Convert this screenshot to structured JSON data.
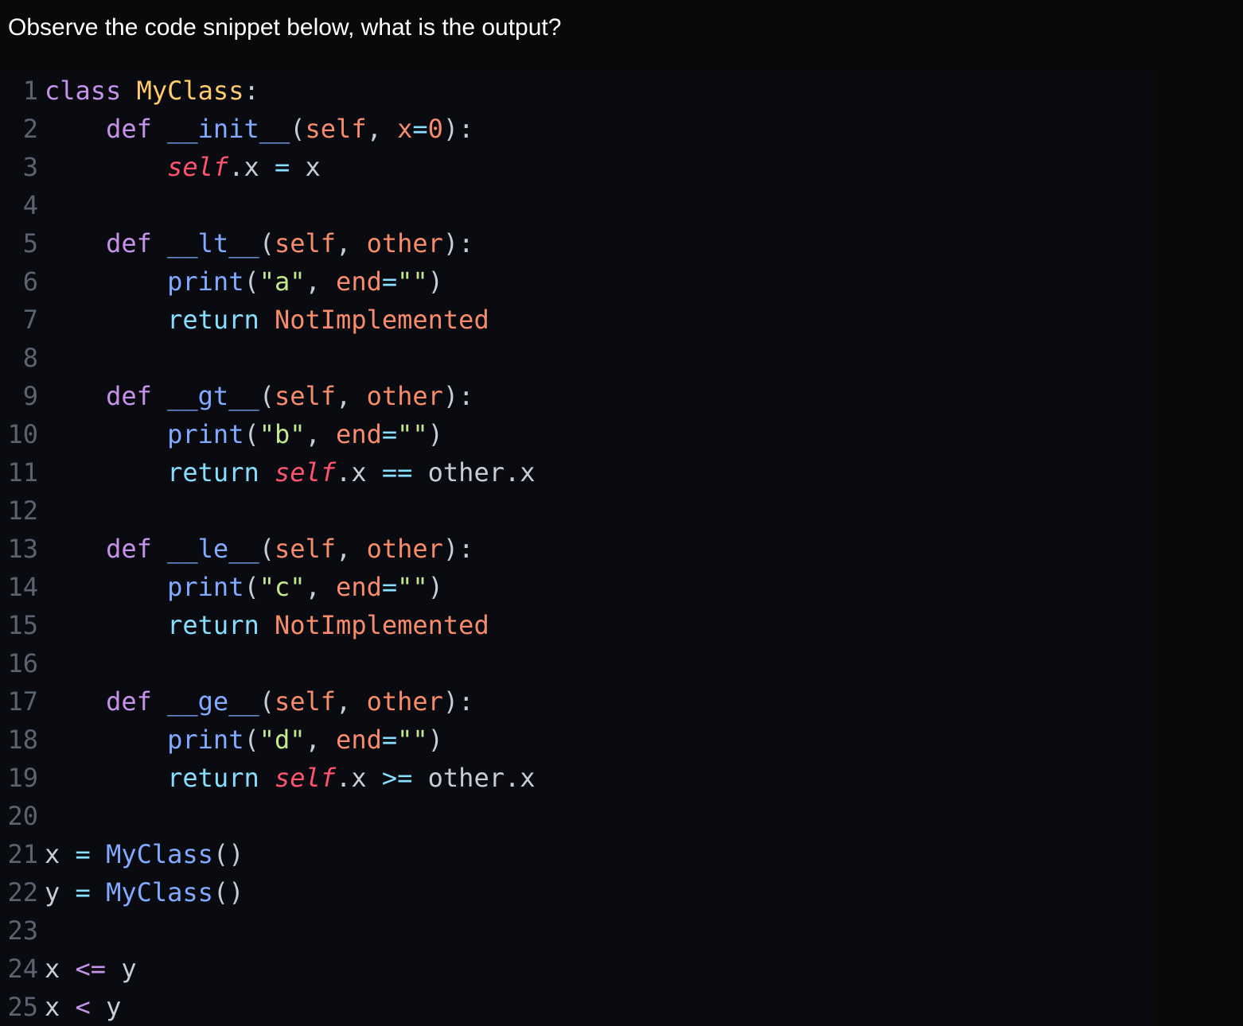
{
  "question": "Observe the code snippet below, what is the output?",
  "code": {
    "language": "python",
    "lines": [
      [
        {
          "t": "class",
          "c": "kw"
        },
        {
          "t": " "
        },
        {
          "t": "MyClass",
          "c": "cls"
        },
        {
          "t": ":"
        }
      ],
      [
        {
          "t": "    "
        },
        {
          "t": "def",
          "c": "kw"
        },
        {
          "t": " "
        },
        {
          "t": "__init__",
          "c": "fn"
        },
        {
          "t": "("
        },
        {
          "t": "self",
          "c": "prm"
        },
        {
          "t": ", "
        },
        {
          "t": "x",
          "c": "prm"
        },
        {
          "t": "=",
          "c": "op"
        },
        {
          "t": "0",
          "c": "num"
        },
        {
          "t": "):"
        }
      ],
      [
        {
          "t": "        "
        },
        {
          "t": "self",
          "c": "self"
        },
        {
          "t": ".x "
        },
        {
          "t": "=",
          "c": "op"
        },
        {
          "t": " x"
        }
      ],
      [],
      [
        {
          "t": "    "
        },
        {
          "t": "def",
          "c": "kw"
        },
        {
          "t": " "
        },
        {
          "t": "__lt__",
          "c": "fn"
        },
        {
          "t": "("
        },
        {
          "t": "self",
          "c": "prm"
        },
        {
          "t": ", "
        },
        {
          "t": "other",
          "c": "prm"
        },
        {
          "t": "):"
        }
      ],
      [
        {
          "t": "        "
        },
        {
          "t": "print",
          "c": "fn"
        },
        {
          "t": "("
        },
        {
          "t": "\"a\"",
          "c": "str"
        },
        {
          "t": ", "
        },
        {
          "t": "end",
          "c": "prm"
        },
        {
          "t": "=",
          "c": "op"
        },
        {
          "t": "\"\"",
          "c": "str"
        },
        {
          "t": ")"
        }
      ],
      [
        {
          "t": "        "
        },
        {
          "t": "return",
          "c": "ret"
        },
        {
          "t": " "
        },
        {
          "t": "NotImplemented",
          "c": "cst"
        }
      ],
      [],
      [
        {
          "t": "    "
        },
        {
          "t": "def",
          "c": "kw"
        },
        {
          "t": " "
        },
        {
          "t": "__gt__",
          "c": "fn"
        },
        {
          "t": "("
        },
        {
          "t": "self",
          "c": "prm"
        },
        {
          "t": ", "
        },
        {
          "t": "other",
          "c": "prm"
        },
        {
          "t": "):"
        }
      ],
      [
        {
          "t": "        "
        },
        {
          "t": "print",
          "c": "fn"
        },
        {
          "t": "("
        },
        {
          "t": "\"b\"",
          "c": "str"
        },
        {
          "t": ", "
        },
        {
          "t": "end",
          "c": "prm"
        },
        {
          "t": "=",
          "c": "op"
        },
        {
          "t": "\"\"",
          "c": "str"
        },
        {
          "t": ")"
        }
      ],
      [
        {
          "t": "        "
        },
        {
          "t": "return",
          "c": "ret"
        },
        {
          "t": " "
        },
        {
          "t": "self",
          "c": "self"
        },
        {
          "t": ".x "
        },
        {
          "t": "==",
          "c": "op"
        },
        {
          "t": " other.x"
        }
      ],
      [],
      [
        {
          "t": "    "
        },
        {
          "t": "def",
          "c": "kw"
        },
        {
          "t": " "
        },
        {
          "t": "__le__",
          "c": "fn"
        },
        {
          "t": "("
        },
        {
          "t": "self",
          "c": "prm"
        },
        {
          "t": ", "
        },
        {
          "t": "other",
          "c": "prm"
        },
        {
          "t": "):"
        }
      ],
      [
        {
          "t": "        "
        },
        {
          "t": "print",
          "c": "fn"
        },
        {
          "t": "("
        },
        {
          "t": "\"c\"",
          "c": "str"
        },
        {
          "t": ", "
        },
        {
          "t": "end",
          "c": "prm"
        },
        {
          "t": "=",
          "c": "op"
        },
        {
          "t": "\"\"",
          "c": "str"
        },
        {
          "t": ")"
        }
      ],
      [
        {
          "t": "        "
        },
        {
          "t": "return",
          "c": "ret"
        },
        {
          "t": " "
        },
        {
          "t": "NotImplemented",
          "c": "cst"
        }
      ],
      [],
      [
        {
          "t": "    "
        },
        {
          "t": "def",
          "c": "kw"
        },
        {
          "t": " "
        },
        {
          "t": "__ge__",
          "c": "fn"
        },
        {
          "t": "("
        },
        {
          "t": "self",
          "c": "prm"
        },
        {
          "t": ", "
        },
        {
          "t": "other",
          "c": "prm"
        },
        {
          "t": "):"
        }
      ],
      [
        {
          "t": "        "
        },
        {
          "t": "print",
          "c": "fn"
        },
        {
          "t": "("
        },
        {
          "t": "\"d\"",
          "c": "str"
        },
        {
          "t": ", "
        },
        {
          "t": "end",
          "c": "prm"
        },
        {
          "t": "=",
          "c": "op"
        },
        {
          "t": "\"\"",
          "c": "str"
        },
        {
          "t": ")"
        }
      ],
      [
        {
          "t": "        "
        },
        {
          "t": "return",
          "c": "ret"
        },
        {
          "t": " "
        },
        {
          "t": "self",
          "c": "self"
        },
        {
          "t": ".x "
        },
        {
          "t": ">=",
          "c": "op"
        },
        {
          "t": " other.x"
        }
      ],
      [],
      [
        {
          "t": "x "
        },
        {
          "t": "=",
          "c": "op"
        },
        {
          "t": " "
        },
        {
          "t": "MyClass",
          "c": "fn"
        },
        {
          "t": "()"
        }
      ],
      [
        {
          "t": "y "
        },
        {
          "t": "=",
          "c": "op"
        },
        {
          "t": " "
        },
        {
          "t": "MyClass",
          "c": "fn"
        },
        {
          "t": "()"
        }
      ],
      [],
      [
        {
          "t": "x "
        },
        {
          "t": "<=",
          "c": "kw"
        },
        {
          "t": " y"
        }
      ],
      [
        {
          "t": "x "
        },
        {
          "t": "<",
          "c": "kw"
        },
        {
          "t": " y"
        }
      ]
    ]
  }
}
